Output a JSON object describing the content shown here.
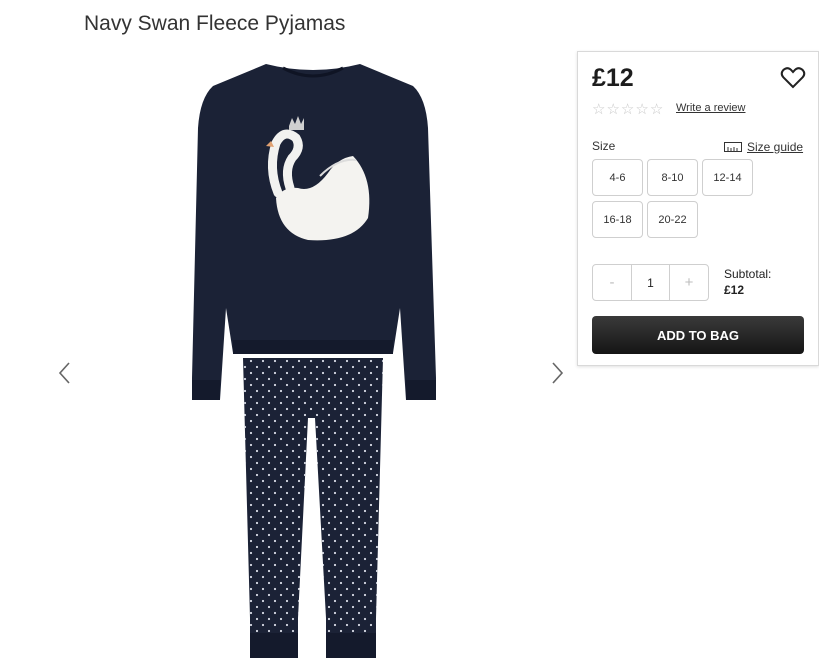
{
  "product": {
    "title": "Navy Swan Fleece Pyjamas",
    "price": "£12"
  },
  "reviews": {
    "rating": 0,
    "max": 5,
    "star_glyph": "☆",
    "link_label": "Write a review"
  },
  "size": {
    "label": "Size",
    "guide_label": "Size guide",
    "options": [
      "4-6",
      "8-10",
      "12-14",
      "16-18",
      "20-22"
    ]
  },
  "quantity": {
    "decrement": "-",
    "value": "1",
    "increment": "+"
  },
  "subtotal": {
    "label": "Subtotal:",
    "amount": "£12"
  },
  "cta": {
    "add_to_bag": "ADD TO BAG"
  },
  "icons": {
    "prev": "chevron-left-icon",
    "next": "chevron-right-icon",
    "wishlist": "heart-icon",
    "size_guide": "ruler-icon"
  },
  "colors": {
    "garment": "#1b2236",
    "button_dark": "#1f1f1f"
  }
}
